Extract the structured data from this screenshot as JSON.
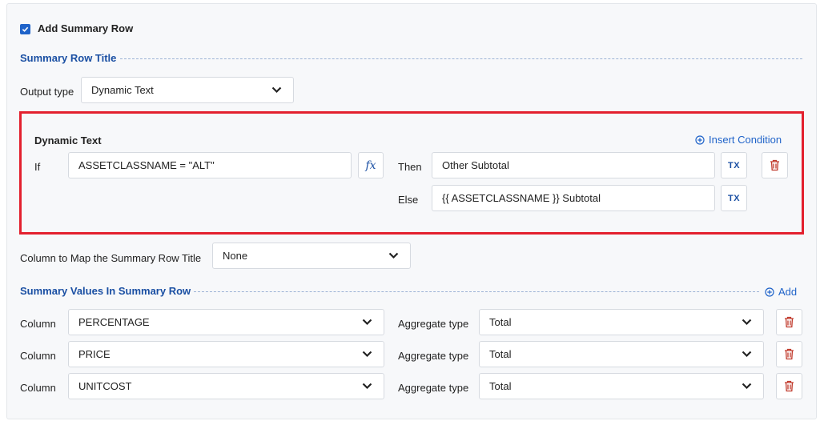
{
  "add_summary_row": {
    "label": "Add Summary Row",
    "checked": true
  },
  "summary_row_title": {
    "title": "Summary Row Title"
  },
  "output_type": {
    "label": "Output type",
    "value": "Dynamic Text"
  },
  "dynamic_text": {
    "title": "Dynamic Text",
    "insert_condition_label": "Insert Condition",
    "if_label": "If",
    "condition": "ASSETCLASSNAME = \"ALT\"",
    "fx_label": "fx",
    "then_label": "Then",
    "then_value": "Other Subtotal",
    "else_label": "Else",
    "else_value": "{{ ASSETCLASSNAME }} Subtotal",
    "tx_label": "TX"
  },
  "column_map": {
    "label": "Column to Map the Summary Row Title",
    "value": "None"
  },
  "summary_values": {
    "title": "Summary Values In Summary Row",
    "add_label": "Add",
    "column_label": "Column",
    "aggregate_label": "Aggregate type",
    "rows": [
      {
        "column": "PERCENTAGE",
        "aggregate": "Total"
      },
      {
        "column": "PRICE",
        "aggregate": "Total"
      },
      {
        "column": "UNITCOST",
        "aggregate": "Total"
      }
    ]
  },
  "colors": {
    "accent": "#1f63c9",
    "title_blue": "#1a4fa3",
    "highlight_red": "#e3202e",
    "delete_red": "#c0392b"
  }
}
